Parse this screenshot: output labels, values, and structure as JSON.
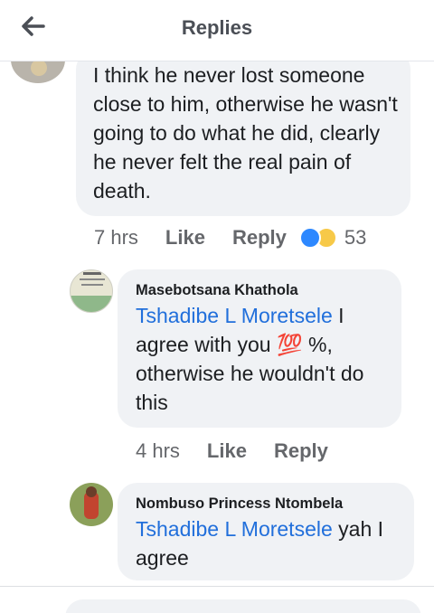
{
  "header": {
    "title": "Replies"
  },
  "comments": [
    {
      "text": "I think he never lost someone close to him, otherwise he wasn't going to do what he did, clearly he never felt the real pain of death.",
      "time": "7 hrs",
      "like": "Like",
      "reply": "Reply",
      "reaction_count": "53",
      "reactions": [
        "like-icon",
        "sad-icon"
      ]
    },
    {
      "author": "Masebotsana Khathola",
      "mention": "Tshadibe L Moretsele",
      "text": " I agree with you 💯 %, otherwise  he wouldn't do this",
      "time": "4 hrs",
      "like": "Like",
      "reply": "Reply"
    },
    {
      "author": "Nombuso Princess Ntombela",
      "mention": "Tshadibe L Moretsele",
      "text": " yah I agree"
    }
  ],
  "colors": {
    "mention": "#216fdb",
    "bubble": "#f0f2f5",
    "secondary_text": "#65676b"
  }
}
